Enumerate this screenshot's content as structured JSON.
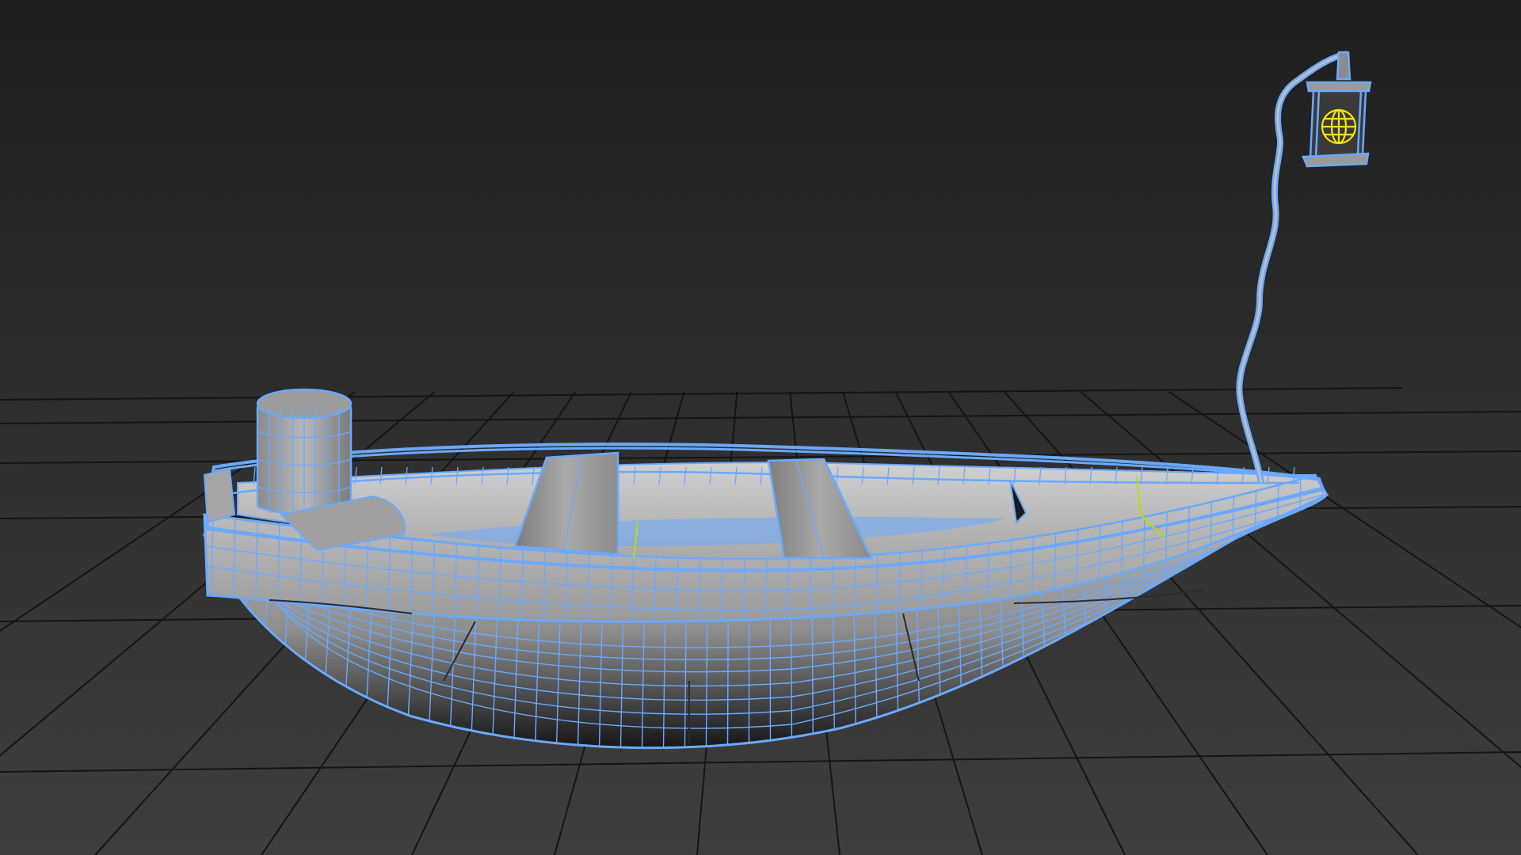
{
  "viewport": {
    "background": {
      "top": "#1e1e1e",
      "bottom": "#3e3e3e"
    },
    "grid_color": "#141414",
    "wire_color": "#6aa9ff",
    "shade_light": "#c4c4c4",
    "shade_dark": "#4a4a4a",
    "light_gizmo_color": "#ffe600",
    "pivot_color": "#b4e000"
  },
  "scene": {
    "objects": [
      {
        "name": "boat-hull",
        "selected": true
      },
      {
        "name": "boat-seat-front",
        "selected": true
      },
      {
        "name": "boat-seat-rear",
        "selected": true
      },
      {
        "name": "bow-bollard",
        "selected": true
      },
      {
        "name": "lantern-pole",
        "selected": true
      },
      {
        "name": "lantern",
        "selected": true
      },
      {
        "name": "point-light",
        "selected": true
      }
    ]
  }
}
